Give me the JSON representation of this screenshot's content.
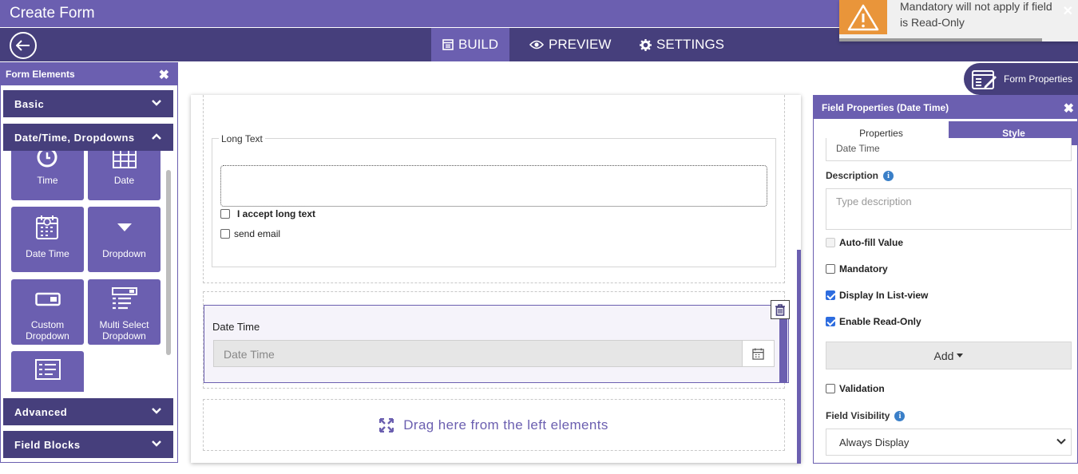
{
  "app": {
    "title": "Create Form"
  },
  "nav": {
    "tabs": [
      {
        "label": "BUILD",
        "icon": "build-icon",
        "active": true
      },
      {
        "label": "PREVIEW",
        "icon": "eye-icon",
        "active": false
      },
      {
        "label": "SETTINGS",
        "icon": "gear-icon",
        "active": false
      }
    ]
  },
  "toast": {
    "message": "Mandatory will not apply if field is Read-Only"
  },
  "left_panel": {
    "title": "Form Elements",
    "sections": {
      "basic": "Basic",
      "datetime": "Date/Time, Dropdowns",
      "advanced": "Advanced",
      "field_blocks": "Field Blocks"
    },
    "elements": [
      {
        "label": "Time",
        "icon": "clock-icon"
      },
      {
        "label": "Date",
        "icon": "calendar-grid-icon"
      },
      {
        "label": "Date Time",
        "icon": "calendar-clock-icon"
      },
      {
        "label": "Dropdown",
        "icon": "caret-down-icon"
      },
      {
        "label": "Custom Dropdown",
        "icon": "custom-dropdown-icon"
      },
      {
        "label": "Multi Select Dropdown",
        "icon": "list-select-icon"
      },
      {
        "label": "",
        "icon": "list-icon"
      }
    ]
  },
  "canvas": {
    "long_text": {
      "legend": "Long Text",
      "checkbox1": "I accept long text",
      "checkbox2": "send email"
    },
    "date_time": {
      "label": "Date Time",
      "placeholder": "Date Time"
    },
    "drop_zone": "Drag here from the left elements"
  },
  "form_properties": {
    "label": "Form Properties"
  },
  "field_properties": {
    "title": "Field Properties (Date Time)",
    "tabs": {
      "properties": "Properties",
      "style": "Style"
    },
    "label_value": "Date Time",
    "description_label": "Description",
    "description_placeholder": "Type description",
    "options": {
      "autofill": {
        "label": "Auto-fill Value",
        "checked": false,
        "disabled": true
      },
      "mandatory": {
        "label": "Mandatory",
        "checked": false
      },
      "list_view": {
        "label": "Display In List-view",
        "checked": true
      },
      "read_only": {
        "label": "Enable Read-Only",
        "checked": true
      },
      "validation": {
        "label": "Validation",
        "checked": false
      }
    },
    "add_label": "Add",
    "visibility_label": "Field Visibility",
    "visibility_value": "Always Display"
  },
  "colors": {
    "primary": "#6b5fb0",
    "dark": "#463f7c",
    "warning": "#e9953a",
    "info": "#3a7fc8"
  }
}
